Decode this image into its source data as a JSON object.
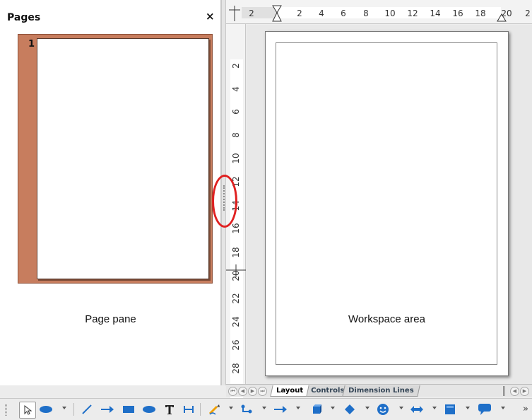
{
  "pages_pane": {
    "title": "Pages",
    "close_glyph": "×",
    "thumbnail": {
      "page_number": "1",
      "selected": true
    },
    "label": "Page pane"
  },
  "workspace": {
    "label": "Workspace area"
  },
  "ruler": {
    "horizontal_ticks": [
      "2",
      "2",
      "4",
      "6",
      "8",
      "10",
      "12",
      "14",
      "16",
      "18",
      "20",
      "2"
    ],
    "vertical_ticks": [
      "2",
      "4",
      "6",
      "8",
      "10",
      "12",
      "14",
      "16",
      "18",
      "20",
      "22",
      "24",
      "26",
      "28"
    ]
  },
  "tabs": [
    {
      "label": "Layout",
      "active": true
    },
    {
      "label": "Controls",
      "active": false
    },
    {
      "label": "Dimension Lines",
      "active": false
    }
  ],
  "toolbar": {
    "items": [
      "select-icon",
      "ellipse-icon",
      "line-icon",
      "arrow-line-icon",
      "rectangle-icon",
      "ellipse-icon",
      "text-icon",
      "dimension-line-icon",
      "curve-icon",
      "connector-icon",
      "lines-arrows-icon",
      "3d-object-icon",
      "basic-shapes-icon",
      "symbol-shapes-icon",
      "block-arrows-icon",
      "flowchart-icon",
      "callout-icon"
    ],
    "overflow_glyph": "»"
  },
  "colors": {
    "thumbnail_selection": "#c77d5e",
    "highlight_oval": "#e02020",
    "icon_blue": "#1f6fc8"
  }
}
